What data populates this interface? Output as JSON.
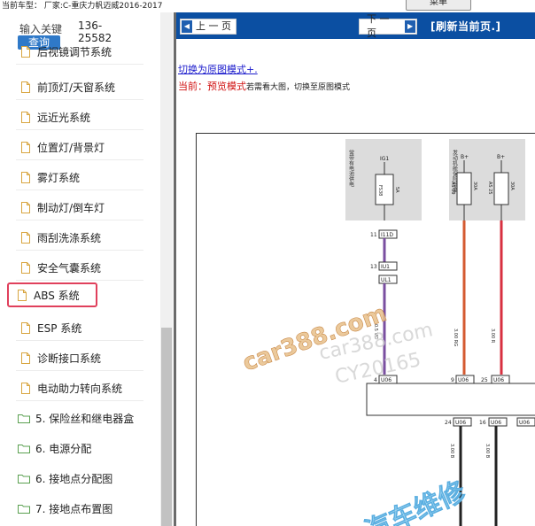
{
  "header": {
    "car_type": "当前车型：  厂家:C-重庆力帆迈威2016-2017",
    "menu_label": "菜单"
  },
  "sidebar": {
    "search_label": "输入关键",
    "search_button": "查询",
    "phone_line1": "136-",
    "phone_line2": "25582",
    "items": [
      {
        "label": "后视镜调节系统",
        "type": "doc"
      },
      {
        "label": "前顶灯/天窗系统",
        "type": "doc"
      },
      {
        "label": "远近光系统",
        "type": "doc"
      },
      {
        "label": "位置灯/背景灯",
        "type": "doc"
      },
      {
        "label": "雾灯系统",
        "type": "doc"
      },
      {
        "label": "制动灯/倒车灯",
        "type": "doc"
      },
      {
        "label": "雨刮洗涤系统",
        "type": "doc"
      },
      {
        "label": "安全气囊系统",
        "type": "doc"
      },
      {
        "label": "ABS 系统",
        "type": "doc"
      },
      {
        "label": "ESP 系统",
        "type": "doc"
      },
      {
        "label": "诊断接口系统",
        "type": "doc"
      },
      {
        "label": "电动助力转向系统",
        "type": "doc"
      },
      {
        "label": "5. 保险丝和继电器盒",
        "type": "folder"
      },
      {
        "label": "6. 电源分配",
        "type": "folder"
      },
      {
        "label": "6. 接地点分配图",
        "type": "folder"
      },
      {
        "label": "7. 接地点布置图",
        "type": "folder"
      }
    ]
  },
  "main": {
    "prev_label": "上 一 页",
    "next_label": "下 一 页",
    "refresh_label": "[刷新当前页.]",
    "switch_link": "切换为原图模式+.",
    "mode_prefix": "当前：",
    "mode_name": "预览模式",
    "mode_hint": "若需看大图，切换至原图模式"
  },
  "diagram": {
    "box1_text": "常带有电池供电",
    "box2_text": "发动机舱保险丝盒",
    "ig1": "IG1",
    "b_plus_1": "B+",
    "b_plus_2": "B+",
    "fuse1": "FS38",
    "fuse1_amp": "5A",
    "fuse2": "AS 09",
    "fuse2_amp": "30A",
    "fuse3": "AS 25",
    "fuse3_amp": "30A",
    "conn_11": "11",
    "conn_I1D": "I11D",
    "conn_13": "13",
    "conn_IU1": "IU1",
    "conn_IL1": "UL1",
    "wire_vg": "0.5 VG",
    "wire_rg": "3.00 RG",
    "wire_r": "3.00 R",
    "pin_4": "4",
    "pin_u06a": "U06",
    "pin_9": "9",
    "pin_u06b": "U06",
    "pin_25": "25",
    "pin_u06c": "U06",
    "pin_24": "24",
    "pin_u06d": "U06",
    "pin_16": "16",
    "pin_u06e": "U06",
    "pin_u06f": "U06",
    "wire_b1": "3.00 B",
    "wire_b2": "3.00 B",
    "watermark1": "car388.com",
    "watermark2": "car388.com",
    "watermark3": "CY20165",
    "watermark4": "汽车维修"
  },
  "colors": {
    "nav_blue": "#0b4fa2",
    "search_blue": "#2f79c8",
    "highlight_red": "#e0405c",
    "link_blue": "#1a1acc",
    "mode_red": "#d01010"
  }
}
